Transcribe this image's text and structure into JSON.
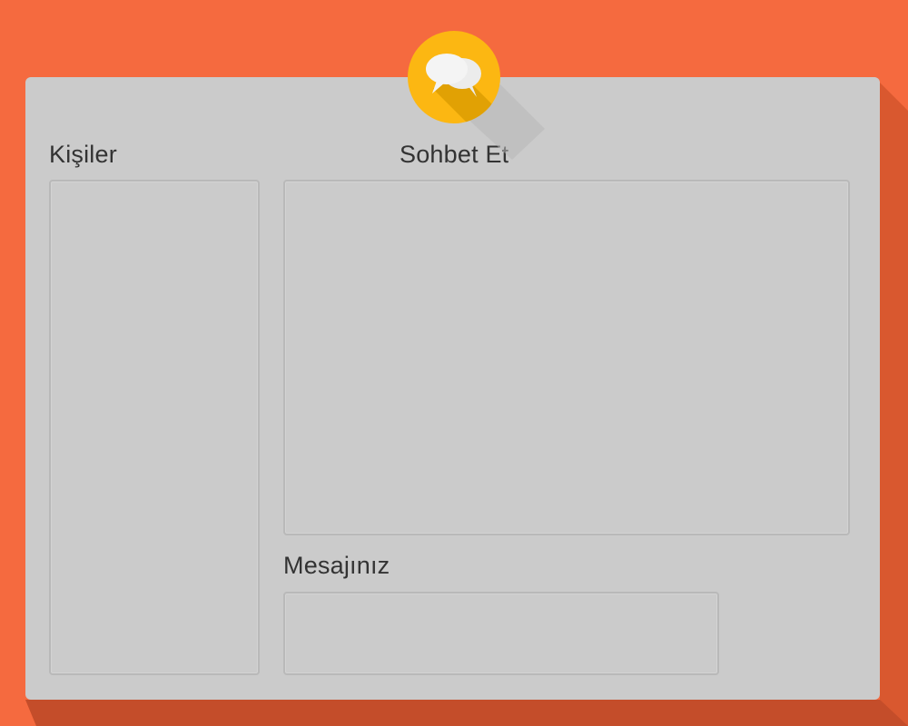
{
  "app": {
    "icon": "chat-bubbles-icon",
    "accent_color": "#fcb712",
    "background_color": "#f56a3f",
    "panel_color": "#cbcbcb"
  },
  "contacts": {
    "title": "Kişiler"
  },
  "chat": {
    "title": "Sohbet Et"
  },
  "message": {
    "title": "Mesajınız",
    "value": ""
  }
}
